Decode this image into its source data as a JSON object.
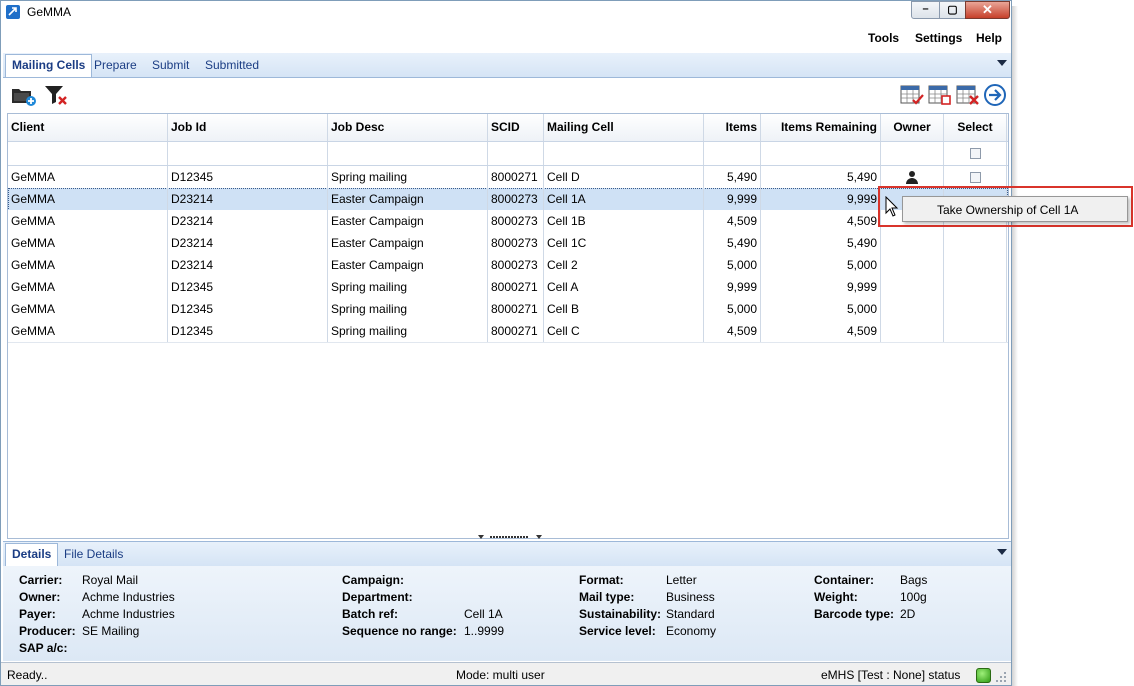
{
  "window": {
    "title": "GeMMA"
  },
  "menu": [
    "Tools",
    "Settings",
    "Help"
  ],
  "tabs": [
    {
      "label": "Mailing Cells",
      "active": true
    },
    {
      "label": "Prepare",
      "active": false
    },
    {
      "label": "Submit",
      "active": false
    },
    {
      "label": "Submitted",
      "active": false
    }
  ],
  "toolbar": {
    "left_icons": [
      "add-folder-icon",
      "clear-filter-icon"
    ],
    "right_icons": [
      "grid-check-icon",
      "grid-blank-icon",
      "grid-delete-icon",
      "arrow-right-circle-icon"
    ]
  },
  "grid": {
    "columns": [
      "Client",
      "Job Id",
      "Job Desc",
      "SCID",
      "Mailing Cell",
      "Items",
      "Items Remaining",
      "Owner",
      "Select"
    ],
    "rows": [
      {
        "client": "GeMMA",
        "job_id": "D12345",
        "job_desc": "Spring mailing",
        "scid": "8000271",
        "cell": "Cell D",
        "items": "5,490",
        "remaining": "5,490",
        "owner": "person-icon",
        "select": "checkbox",
        "selected": false
      },
      {
        "client": "GeMMA",
        "job_id": "D23214",
        "job_desc": "Easter Campaign",
        "scid": "8000273",
        "cell": "Cell 1A",
        "items": "9,999",
        "remaining": "9,999",
        "owner": "",
        "select": "",
        "selected": true
      },
      {
        "client": "GeMMA",
        "job_id": "D23214",
        "job_desc": "Easter Campaign",
        "scid": "8000273",
        "cell": "Cell 1B",
        "items": "4,509",
        "remaining": "4,509",
        "owner": "",
        "select": "",
        "selected": false
      },
      {
        "client": "GeMMA",
        "job_id": "D23214",
        "job_desc": "Easter Campaign",
        "scid": "8000273",
        "cell": "Cell 1C",
        "items": "5,490",
        "remaining": "5,490",
        "owner": "",
        "select": "",
        "selected": false
      },
      {
        "client": "GeMMA",
        "job_id": "D23214",
        "job_desc": "Easter Campaign",
        "scid": "8000273",
        "cell": "Cell 2",
        "items": "5,000",
        "remaining": "5,000",
        "owner": "",
        "select": "",
        "selected": false
      },
      {
        "client": "GeMMA",
        "job_id": "D12345",
        "job_desc": "Spring mailing",
        "scid": "8000271",
        "cell": "Cell A",
        "items": "9,999",
        "remaining": "9,999",
        "owner": "",
        "select": "",
        "selected": false
      },
      {
        "client": "GeMMA",
        "job_id": "D12345",
        "job_desc": "Spring mailing",
        "scid": "8000271",
        "cell": "Cell B",
        "items": "5,000",
        "remaining": "5,000",
        "owner": "",
        "select": "",
        "selected": false
      },
      {
        "client": "GeMMA",
        "job_id": "D12345",
        "job_desc": "Spring mailing",
        "scid": "8000271",
        "cell": "Cell C",
        "items": "4,509",
        "remaining": "4,509",
        "owner": "",
        "select": "",
        "selected": false
      }
    ]
  },
  "context_menu": {
    "item": "Take Ownership of Cell 1A"
  },
  "details_tabs": [
    {
      "label": "Details",
      "active": true
    },
    {
      "label": "File Details",
      "active": false
    }
  ],
  "details": {
    "col1": [
      {
        "label": "Carrier:",
        "value": "Royal Mail"
      },
      {
        "label": "Owner:",
        "value": "Achme Industries"
      },
      {
        "label": "Payer:",
        "value": "Achme Industries"
      },
      {
        "label": "Producer:",
        "value": "SE Mailing"
      },
      {
        "label": "SAP a/c:",
        "value": ""
      }
    ],
    "col2": [
      {
        "label": "Campaign:",
        "value": ""
      },
      {
        "label": "Department:",
        "value": ""
      },
      {
        "label": "Batch ref:",
        "value": "Cell 1A"
      },
      {
        "label": "Sequence no range:",
        "value": "1..9999"
      }
    ],
    "col3": [
      {
        "label": "Format:",
        "value": "Letter"
      },
      {
        "label": "Mail type:",
        "value": "Business"
      },
      {
        "label": "Sustainability:",
        "value": "Standard"
      },
      {
        "label": "Service level:",
        "value": "Economy"
      }
    ],
    "col4": [
      {
        "label": "Container:",
        "value": "Bags"
      },
      {
        "label": "Weight:",
        "value": "100g"
      },
      {
        "label": "Barcode type:",
        "value": "2D"
      }
    ]
  },
  "status": {
    "left": "Ready..",
    "mode": "Mode: multi user",
    "emhs": "eMHS [Test : None] status",
    "led_color": "#3cb01e"
  }
}
